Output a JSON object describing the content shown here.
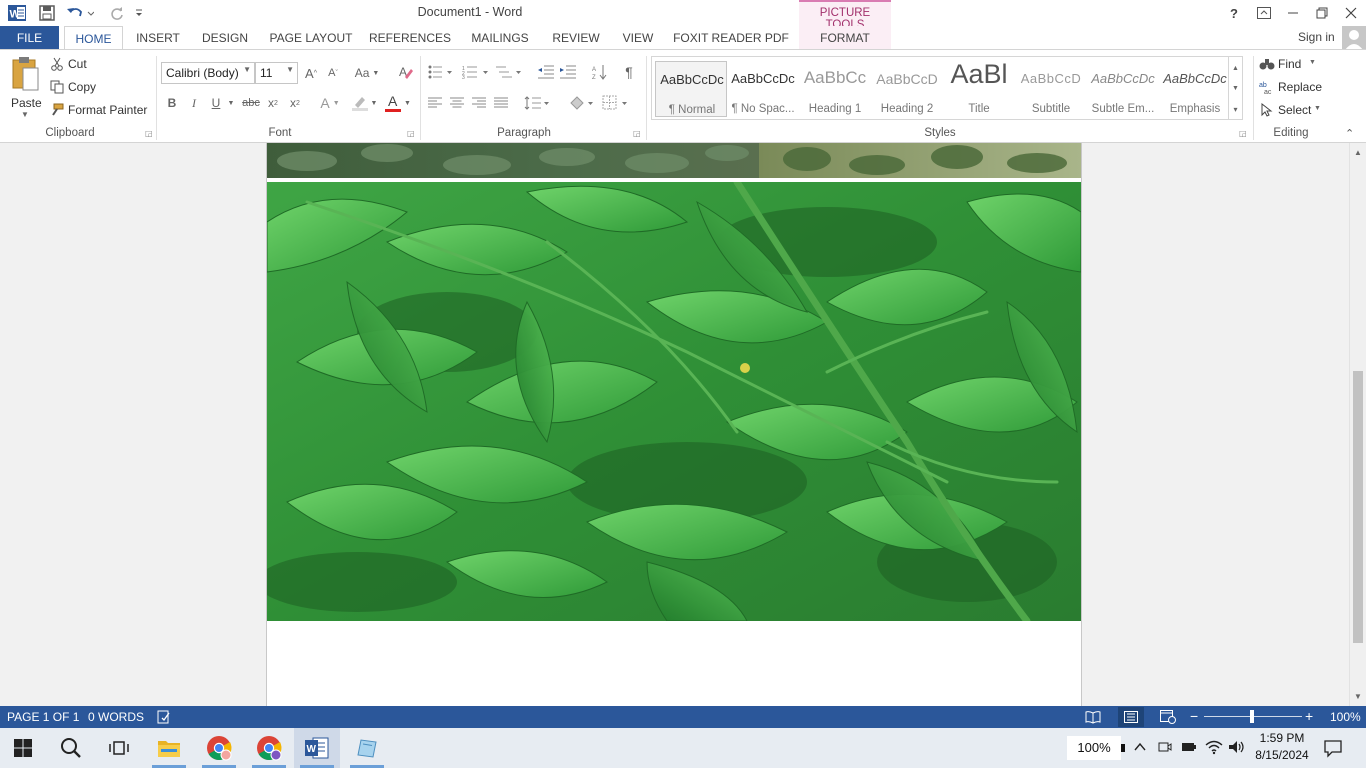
{
  "window": {
    "title": "Document1 - Word",
    "context_tab_header": "PICTURE TOOLS",
    "help": "?",
    "sign_in": "Sign in"
  },
  "tabs": [
    {
      "label": "FILE"
    },
    {
      "label": "HOME"
    },
    {
      "label": "INSERT"
    },
    {
      "label": "DESIGN"
    },
    {
      "label": "PAGE LAYOUT"
    },
    {
      "label": "REFERENCES"
    },
    {
      "label": "MAILINGS"
    },
    {
      "label": "REVIEW"
    },
    {
      "label": "VIEW"
    },
    {
      "label": "FOXIT READER PDF"
    },
    {
      "label": "FORMAT"
    }
  ],
  "ribbon": {
    "clipboard": {
      "label": "Clipboard",
      "paste": "Paste",
      "cut": "Cut",
      "copy": "Copy",
      "format_painter": "Format Painter"
    },
    "font": {
      "label": "Font",
      "family": "Calibri (Body)",
      "size": "11",
      "change_case": "Aa",
      "bold": "B",
      "italic": "I",
      "underline": "U",
      "strike": "abc",
      "subscript": "x",
      "superscript": "x",
      "font_color_letter": "A",
      "effects_letter": "A"
    },
    "paragraph": {
      "label": "Paragraph",
      "pilcrow": "¶"
    },
    "styles": {
      "label": "Styles",
      "items": [
        {
          "preview": "AaBbCcDc",
          "name": "¶ Normal"
        },
        {
          "preview": "AaBbCcDc",
          "name": "¶ No Spac..."
        },
        {
          "preview": "AaBbCc",
          "name": "Heading 1"
        },
        {
          "preview": "AaBbCcD",
          "name": "Heading 2"
        },
        {
          "preview": "AaBl",
          "name": "Title"
        },
        {
          "preview": "AaBbCcD",
          "name": "Subtitle"
        },
        {
          "preview": "AaBbCcDc",
          "name": "Subtle Em..."
        },
        {
          "preview": "AaBbCcDc",
          "name": "Emphasis"
        }
      ]
    },
    "editing": {
      "label": "Editing",
      "find": "Find",
      "replace": "Replace",
      "select": "Select"
    }
  },
  "statusbar": {
    "page": "PAGE 1 OF 1",
    "words": "0 WORDS",
    "zoom": "100%"
  },
  "taskbar": {
    "zoom_badge": "100%",
    "time": "1:59 PM",
    "date": "8/15/2024"
  },
  "colors": {
    "word_blue": "#2b579a",
    "picture_tools_pink": "#a2306c",
    "font_color_red": "#e02020"
  }
}
